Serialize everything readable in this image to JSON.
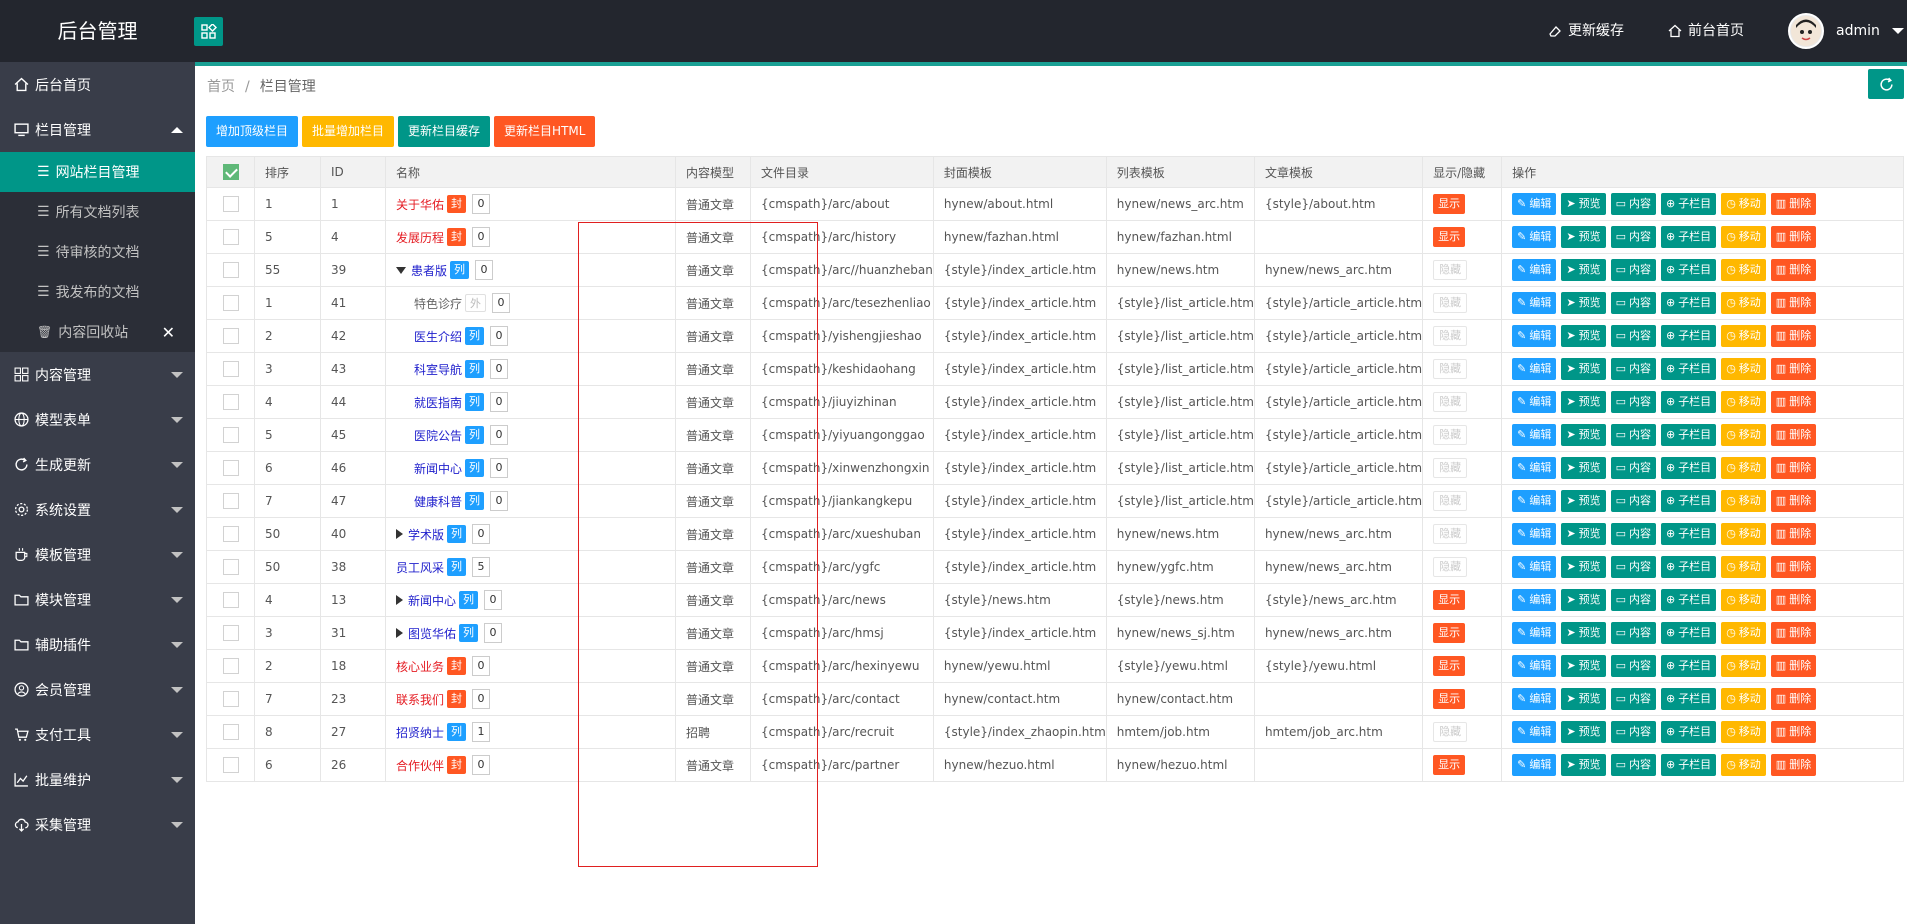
{
  "header": {
    "logo": "后台管理",
    "update_cache": "更新缓存",
    "front_home": "前台首页",
    "user": "admin"
  },
  "sidebar": {
    "items": [
      {
        "label": "后台首页",
        "icon": "home-icon"
      },
      {
        "label": "栏目管理",
        "icon": "monitor-icon",
        "expanded": true
      },
      {
        "label": "内容管理",
        "icon": "grid-icon"
      },
      {
        "label": "模型表单",
        "icon": "globe-icon"
      },
      {
        "label": "生成更新",
        "icon": "refresh-icon"
      },
      {
        "label": "系统设置",
        "icon": "gear-icon"
      },
      {
        "label": "模板管理",
        "icon": "cup-icon"
      },
      {
        "label": "模块管理",
        "icon": "folder-icon"
      },
      {
        "label": "辅助插件",
        "icon": "folder-icon"
      },
      {
        "label": "会员管理",
        "icon": "user-icon"
      },
      {
        "label": "支付工具",
        "icon": "cart-icon"
      },
      {
        "label": "批量维护",
        "icon": "chart-icon"
      },
      {
        "label": "采集管理",
        "icon": "cloud-icon"
      }
    ],
    "sub": [
      {
        "label": "网站栏目管理",
        "active": true
      },
      {
        "label": "所有文档列表"
      },
      {
        "label": "待审核的文档"
      },
      {
        "label": "我发布的文档"
      },
      {
        "label": "内容回收站"
      }
    ]
  },
  "breadcrumb": {
    "home": "首页",
    "sep": "/",
    "current": "栏目管理"
  },
  "toolbar": {
    "add_top": "增加顶级栏目",
    "batch_add": "批量增加栏目",
    "update_cache": "更新栏目缓存",
    "update_html": "更新栏目HTML"
  },
  "table": {
    "headers": [
      "排序",
      "ID",
      "名称",
      "内容模型",
      "文件目录",
      "封面模板",
      "列表模板",
      "文章模板",
      "显示/隐藏",
      "操作"
    ],
    "ops": {
      "edit": "编辑",
      "preview": "预览",
      "content": "内容",
      "child": "子栏目",
      "move": "移动",
      "delete": "删除"
    },
    "show_label": "显示",
    "hide_label": "隐藏",
    "rows": [
      {
        "sort": "1",
        "id": "1",
        "name": "关于华佑",
        "color": "red",
        "tag": "封",
        "tagtype": "feng",
        "count": "0",
        "model": "普通文章",
        "dir": "{cmspath}/arc/about",
        "cover": "hynew/about.html",
        "list": "hynew/news_arc.htm",
        "article": "{style}/about.htm",
        "visible": true,
        "indent": 0,
        "tri": ""
      },
      {
        "sort": "5",
        "id": "4",
        "name": "发展历程",
        "color": "red",
        "tag": "封",
        "tagtype": "feng",
        "count": "0",
        "model": "普通文章",
        "dir": "{cmspath}/arc/history",
        "cover": "hynew/fazhan.html",
        "list": "hynew/fazhan.html",
        "article": "",
        "visible": true,
        "indent": 0,
        "tri": ""
      },
      {
        "sort": "55",
        "id": "39",
        "name": "患者版",
        "color": "blue",
        "tag": "列",
        "tagtype": "lie",
        "count": "0",
        "model": "普通文章",
        "dir": "{cmspath}/arc//huanzheban",
        "cover": "{style}/index_article.htm",
        "list": "hynew/news.htm",
        "article": "hynew/news_arc.htm",
        "visible": false,
        "indent": 0,
        "tri": "down"
      },
      {
        "sort": "1",
        "id": "41",
        "name": "特色诊疗",
        "color": "gray",
        "tag": "外",
        "tagtype": "wai",
        "count": "0",
        "model": "普通文章",
        "dir": "{cmspath}/arc/tesezhenliao",
        "cover": "{style}/index_article.htm",
        "list": "{style}/list_article.htm",
        "article": "{style}/article_article.htm",
        "visible": false,
        "indent": 1,
        "tri": ""
      },
      {
        "sort": "2",
        "id": "42",
        "name": "医生介绍",
        "color": "blue",
        "tag": "列",
        "tagtype": "lie",
        "count": "0",
        "model": "普通文章",
        "dir": "{cmspath}/yishengjieshao",
        "cover": "{style}/index_article.htm",
        "list": "{style}/list_article.htm",
        "article": "{style}/article_article.htm",
        "visible": false,
        "indent": 1,
        "tri": ""
      },
      {
        "sort": "3",
        "id": "43",
        "name": "科室导航",
        "color": "blue",
        "tag": "列",
        "tagtype": "lie",
        "count": "0",
        "model": "普通文章",
        "dir": "{cmspath}/keshidaohang",
        "cover": "{style}/index_article.htm",
        "list": "{style}/list_article.htm",
        "article": "{style}/article_article.htm",
        "visible": false,
        "indent": 1,
        "tri": ""
      },
      {
        "sort": "4",
        "id": "44",
        "name": "就医指南",
        "color": "blue",
        "tag": "列",
        "tagtype": "lie",
        "count": "0",
        "model": "普通文章",
        "dir": "{cmspath}/jiuyizhinan",
        "cover": "{style}/index_article.htm",
        "list": "{style}/list_article.htm",
        "article": "{style}/article_article.htm",
        "visible": false,
        "indent": 1,
        "tri": ""
      },
      {
        "sort": "5",
        "id": "45",
        "name": "医院公告",
        "color": "blue",
        "tag": "列",
        "tagtype": "lie",
        "count": "0",
        "model": "普通文章",
        "dir": "{cmspath}/yiyuangonggao",
        "cover": "{style}/index_article.htm",
        "list": "{style}/list_article.htm",
        "article": "{style}/article_article.htm",
        "visible": false,
        "indent": 1,
        "tri": ""
      },
      {
        "sort": "6",
        "id": "46",
        "name": "新闻中心",
        "color": "blue",
        "tag": "列",
        "tagtype": "lie",
        "count": "0",
        "model": "普通文章",
        "dir": "{cmspath}/xinwenzhongxin",
        "cover": "{style}/index_article.htm",
        "list": "{style}/list_article.htm",
        "article": "{style}/article_article.htm",
        "visible": false,
        "indent": 1,
        "tri": ""
      },
      {
        "sort": "7",
        "id": "47",
        "name": "健康科普",
        "color": "blue",
        "tag": "列",
        "tagtype": "lie",
        "count": "0",
        "model": "普通文章",
        "dir": "{cmspath}/jiankangkepu",
        "cover": "{style}/index_article.htm",
        "list": "{style}/list_article.htm",
        "article": "{style}/article_article.htm",
        "visible": false,
        "indent": 1,
        "tri": ""
      },
      {
        "sort": "50",
        "id": "40",
        "name": "学术版",
        "color": "blue",
        "tag": "列",
        "tagtype": "lie",
        "count": "0",
        "model": "普通文章",
        "dir": "{cmspath}/arc/xueshuban",
        "cover": "{style}/index_article.htm",
        "list": "hynew/news.htm",
        "article": "hynew/news_arc.htm",
        "visible": false,
        "indent": 0,
        "tri": "right"
      },
      {
        "sort": "50",
        "id": "38",
        "name": "员工风采",
        "color": "blue",
        "tag": "列",
        "tagtype": "lie",
        "count": "5",
        "model": "普通文章",
        "dir": "{cmspath}/arc/ygfc",
        "cover": "{style}/index_article.htm",
        "list": "hynew/ygfc.htm",
        "article": "hynew/news_arc.htm",
        "visible": false,
        "indent": 0,
        "tri": ""
      },
      {
        "sort": "4",
        "id": "13",
        "name": "新闻中心",
        "color": "blue",
        "tag": "列",
        "tagtype": "lie",
        "count": "0",
        "model": "普通文章",
        "dir": "{cmspath}/arc/news",
        "cover": "{style}/news.htm",
        "list": "{style}/news.htm",
        "article": "{style}/news_arc.htm",
        "visible": true,
        "indent": 0,
        "tri": "right"
      },
      {
        "sort": "3",
        "id": "31",
        "name": "图览华佑",
        "color": "blue",
        "tag": "列",
        "tagtype": "lie",
        "count": "0",
        "model": "普通文章",
        "dir": "{cmspath}/arc/hmsj",
        "cover": "{style}/index_article.htm",
        "list": "hynew/news_sj.htm",
        "article": "hynew/news_arc.htm",
        "visible": true,
        "indent": 0,
        "tri": "right"
      },
      {
        "sort": "2",
        "id": "18",
        "name": "核心业务",
        "color": "red",
        "tag": "封",
        "tagtype": "feng",
        "count": "0",
        "model": "普通文章",
        "dir": "{cmspath}/arc/hexinyewu",
        "cover": "hynew/yewu.html",
        "list": "{style}/yewu.html",
        "article": "{style}/yewu.html",
        "visible": true,
        "indent": 0,
        "tri": ""
      },
      {
        "sort": "7",
        "id": "23",
        "name": "联系我们",
        "color": "red",
        "tag": "封",
        "tagtype": "feng",
        "count": "0",
        "model": "普通文章",
        "dir": "{cmspath}/arc/contact",
        "cover": "hynew/contact.htm",
        "list": "hynew/contact.htm",
        "article": "",
        "visible": true,
        "indent": 0,
        "tri": ""
      },
      {
        "sort": "8",
        "id": "27",
        "name": "招贤纳士",
        "color": "blue",
        "tag": "列",
        "tagtype": "lie",
        "count": "1",
        "model": "招聘",
        "dir": "{cmspath}/arc/recruit",
        "cover": "{style}/index_zhaopin.htm",
        "list": "hmtem/job.htm",
        "article": "hmtem/job_arc.htm",
        "visible": false,
        "indent": 0,
        "tri": ""
      },
      {
        "sort": "6",
        "id": "26",
        "name": "合作伙伴",
        "color": "red",
        "tag": "封",
        "tagtype": "feng",
        "count": "0",
        "model": "普通文章",
        "dir": "{cmspath}/arc/partner",
        "cover": "hynew/hezuo.html",
        "list": "hynew/hezuo.html",
        "article": "",
        "visible": true,
        "indent": 0,
        "tri": ""
      }
    ]
  }
}
